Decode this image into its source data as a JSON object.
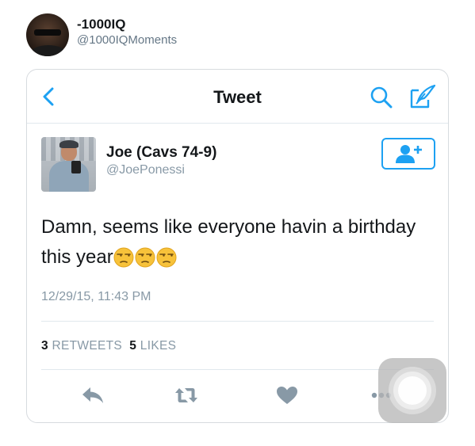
{
  "post": {
    "name": "-1000IQ",
    "handle": "@1000IQMoments"
  },
  "topbar": {
    "title": "Tweet"
  },
  "tweet": {
    "author_name": "Joe (Cavs 74-9)",
    "author_handle": "@JoePonessi",
    "text": "Damn, seems like everyone havin a birthday this year",
    "emojis": [
      "unamused-face",
      "unamused-face",
      "unamused-face"
    ],
    "timestamp": "12/29/15, 11:43 PM",
    "retweets_count": "3",
    "retweets_label": "RETWEETS",
    "likes_count": "5",
    "likes_label": "LIKES"
  },
  "colors": {
    "accent": "#1da1f2",
    "icon_gray": "#8899a6",
    "secondary_text": "#657786",
    "emoji": "#f7c23a"
  },
  "icons": [
    "back-chevron",
    "search",
    "compose",
    "follow-person-plus",
    "reply",
    "retweet",
    "heart",
    "more-dots"
  ]
}
